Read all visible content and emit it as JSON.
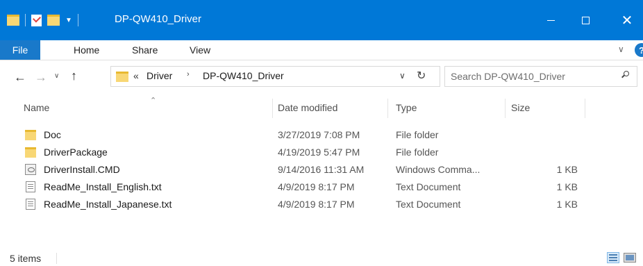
{
  "window": {
    "title": "DP-QW410_Driver",
    "close_glyph": "✕"
  },
  "ribbon": {
    "tabs": [
      "File",
      "Home",
      "Share",
      "View"
    ],
    "help_glyph": "?"
  },
  "address": {
    "more_glyph": "«",
    "separator": "›",
    "segments": [
      "Driver",
      "DP-QW410_Driver"
    ]
  },
  "search": {
    "placeholder": "Search DP-QW410_Driver"
  },
  "columns": [
    "Name",
    "Date modified",
    "Type",
    "Size"
  ],
  "sort": {
    "column": "Name",
    "direction": "ascending"
  },
  "files": [
    {
      "name": "Doc",
      "date": "3/27/2019 7:08 PM",
      "type": "File folder",
      "size": "",
      "icon": "folder-icon"
    },
    {
      "name": "DriverPackage",
      "date": "4/19/2019 5:47 PM",
      "type": "File folder",
      "size": "",
      "icon": "folder-icon"
    },
    {
      "name": "DriverInstall.CMD",
      "date": "9/14/2016 11:31 AM",
      "type": "Windows Comma...",
      "size": "1 KB",
      "icon": "cmd-file-icon"
    },
    {
      "name": "ReadMe_Install_English.txt",
      "date": "4/9/2019 8:17 PM",
      "type": "Text Document",
      "size": "1 KB",
      "icon": "text-file-icon"
    },
    {
      "name": "ReadMe_Install_Japanese.txt",
      "date": "4/9/2019 8:17 PM",
      "type": "Text Document",
      "size": "1 KB",
      "icon": "text-file-icon"
    }
  ],
  "status": {
    "item_count": "5 items"
  },
  "colors": {
    "titlebar": "#0078d7",
    "file_tab": "#1979ca",
    "folder": "#f8d775"
  }
}
